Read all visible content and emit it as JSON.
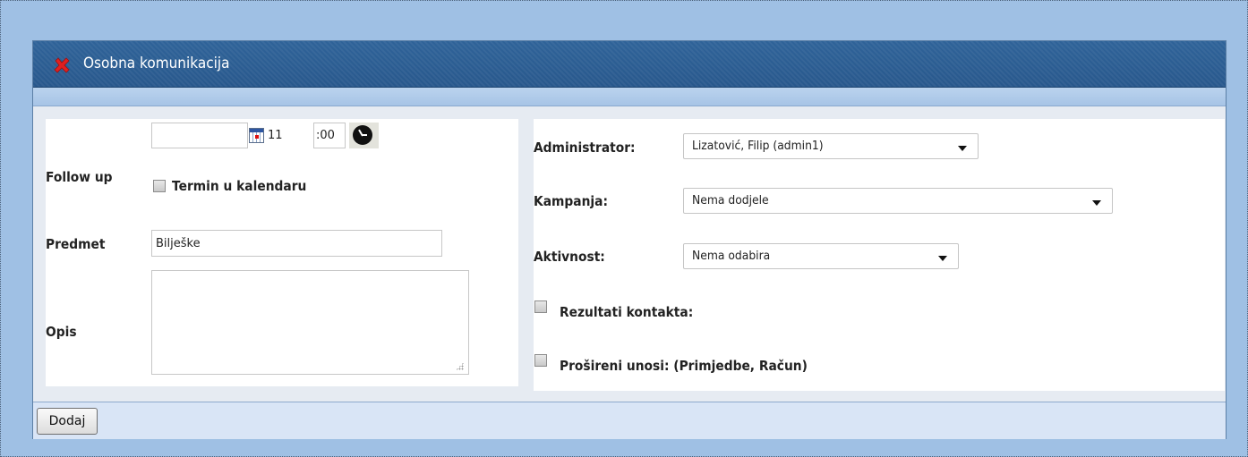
{
  "window": {
    "title": "Osobna komunikacija",
    "close_icon": "close-x-icon",
    "close_color": "#e02020"
  },
  "left": {
    "follow_up_label": "Follow up",
    "date_value": "",
    "hour_value": "11",
    "minute_value": ":00",
    "calendar_icon": "calendar-icon",
    "clock_icon": "clock-icon",
    "calendar_checkbox_label": "Termin u kalendaru",
    "subject_label": "Predmet",
    "subject_value": "Bilješke",
    "description_label": "Opis",
    "description_value": ""
  },
  "right": {
    "administrator_label": "Administrator:",
    "administrator_value": "Lizatović, Filip (admin1)",
    "campaign_label": "Kampanja:",
    "campaign_value": "Nema dodjele",
    "activity_label": "Aktivnost:",
    "activity_value": "Nema odabira",
    "contact_results_label": "Rezultati kontakta:",
    "extended_entries_label": "Prošireni unosi: (Primjedbe, Račun)"
  },
  "footer": {
    "add_button_label": "Dodaj"
  }
}
